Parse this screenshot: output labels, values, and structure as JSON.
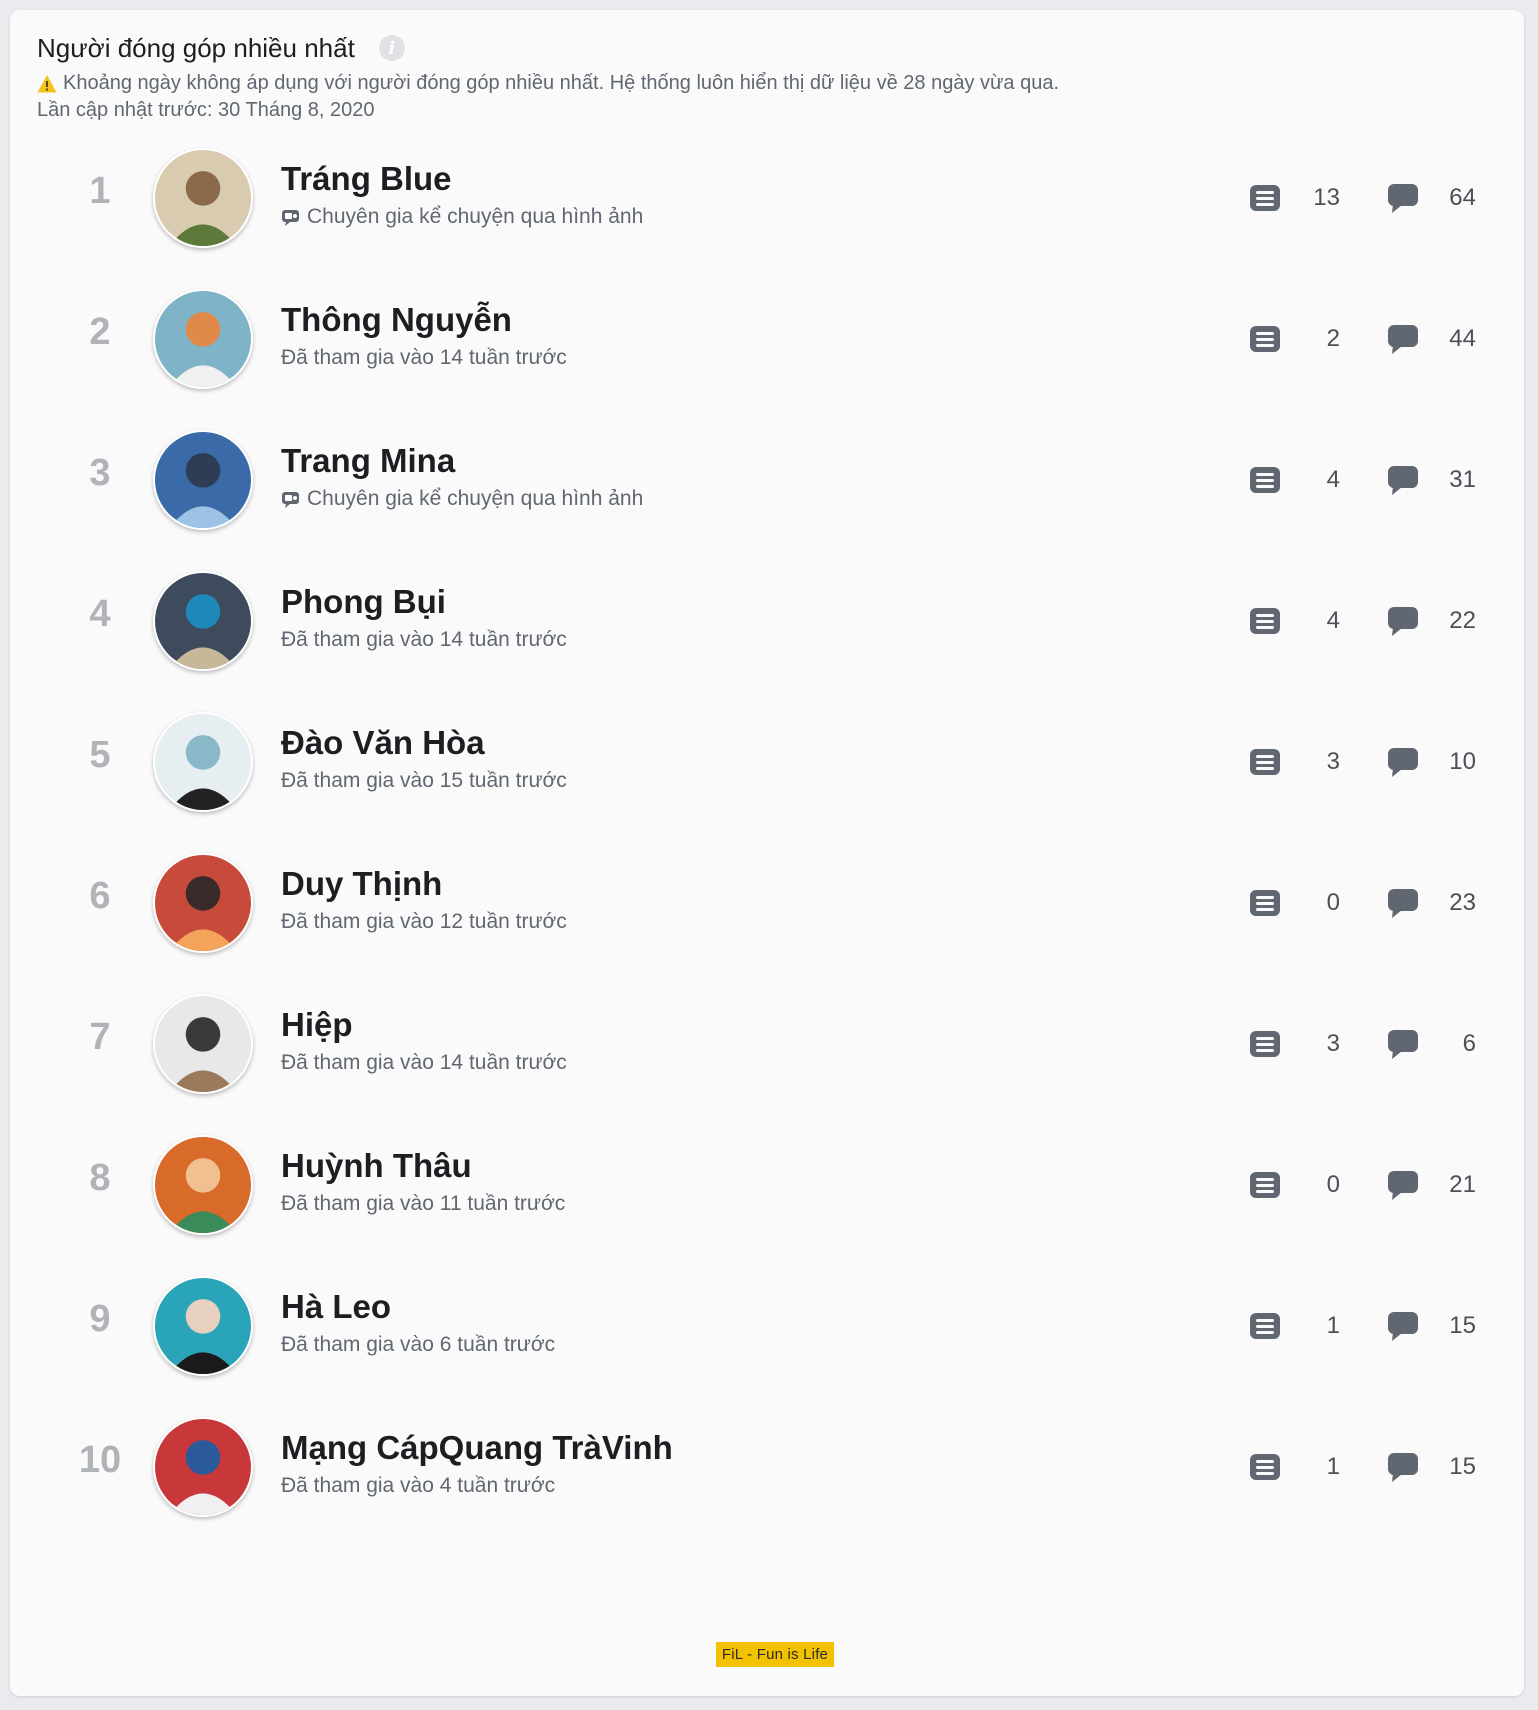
{
  "header": {
    "title": "Người đóng góp nhiều nhất",
    "info_icon": "info-icon",
    "note": "Khoảng ngày không áp dụng với người đóng góp nhiều nhất. Hệ thống luôn hiển thị dữ liệu về 28 ngày vừa qua.",
    "updated": "Lần cập nhật trước: 30 Tháng 8, 2020"
  },
  "colors": {
    "rank": "#b0b3b8",
    "name": "#1c1e21",
    "subtext": "#606770",
    "icon": "#606770",
    "warning": "#f7c21e"
  },
  "contributors": [
    {
      "rank": "1",
      "name": "Tráng Blue",
      "subtitle": "Chuyên gia kể chuyện qua hình ảnh",
      "badge": true,
      "posts": "13",
      "comments": "64"
    },
    {
      "rank": "2",
      "name": "Thông Nguyễn",
      "subtitle": "Đã tham gia vào 14 tuần trước",
      "badge": false,
      "posts": "2",
      "comments": "44"
    },
    {
      "rank": "3",
      "name": "Trang Mina",
      "subtitle": "Chuyên gia kể chuyện qua hình ảnh",
      "badge": true,
      "posts": "4",
      "comments": "31"
    },
    {
      "rank": "4",
      "name": "Phong Bụi",
      "subtitle": "Đã tham gia vào 14 tuần trước",
      "badge": false,
      "posts": "4",
      "comments": "22"
    },
    {
      "rank": "5",
      "name": "Đào Văn Hòa",
      "subtitle": "Đã tham gia vào 15 tuần trước",
      "badge": false,
      "posts": "3",
      "comments": "10"
    },
    {
      "rank": "6",
      "name": "Duy Thịnh",
      "subtitle": "Đã tham gia vào 12 tuần trước",
      "badge": false,
      "posts": "0",
      "comments": "23"
    },
    {
      "rank": "7",
      "name": "Hiệp",
      "subtitle": "Đã tham gia vào 14 tuần trước",
      "badge": false,
      "posts": "3",
      "comments": "6"
    },
    {
      "rank": "8",
      "name": "Huỳnh Thâu",
      "subtitle": "Đã tham gia vào 11 tuần trước",
      "badge": false,
      "posts": "0",
      "comments": "21"
    },
    {
      "rank": "9",
      "name": "Hà Leo",
      "subtitle": "Đã tham gia vào 6 tuần trước",
      "badge": false,
      "posts": "1",
      "comments": "15"
    },
    {
      "rank": "10",
      "name": "Mạng CápQuang TràVinh",
      "subtitle": "Đã tham gia vào 4 tuần trước",
      "badge": false,
      "posts": "1",
      "comments": "15"
    }
  ],
  "watermark": "FiL - Fun is Life"
}
